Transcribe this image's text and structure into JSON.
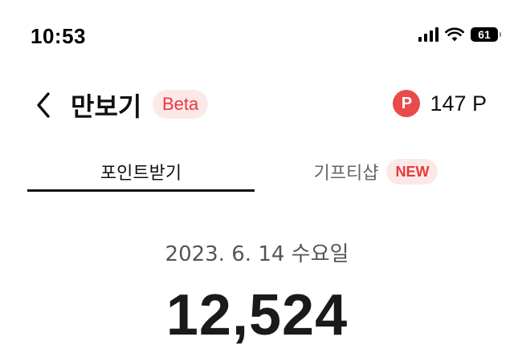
{
  "status_bar": {
    "time": "10:53",
    "battery_level": "61",
    "icons": [
      "cellular-signal-icon",
      "wifi-icon",
      "battery-icon"
    ]
  },
  "header": {
    "back_icon": "chevron-left-icon",
    "title": "만보기",
    "badge": "Beta",
    "points_icon": "P",
    "points": "147 P"
  },
  "tabs": [
    {
      "label": "포인트받기",
      "active": true
    },
    {
      "label": "기프티샵",
      "badge": "NEW",
      "active": false
    }
  ],
  "main": {
    "date": "2023. 6. 14 수요일",
    "steps": "12,524"
  },
  "colors": {
    "accent": "#e94b4b",
    "badge_bg": "#fde8e8",
    "badge_text": "#e53b3b"
  }
}
